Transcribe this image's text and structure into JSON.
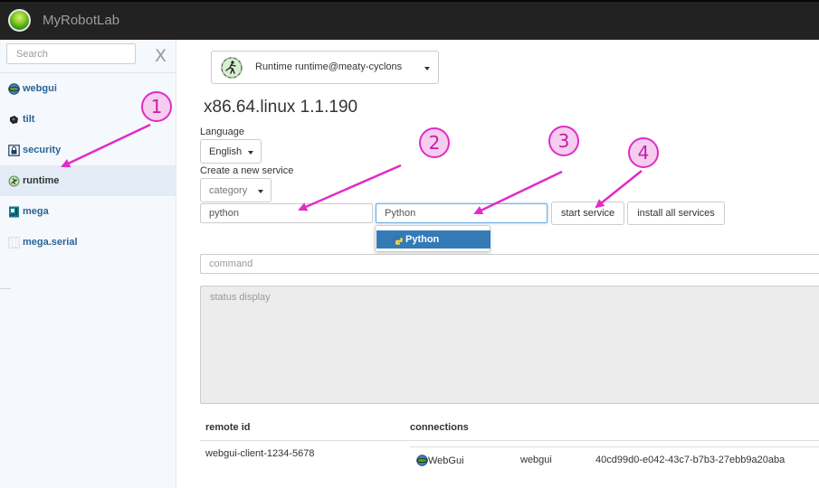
{
  "app": {
    "title": "MyRobotLab"
  },
  "sidebar": {
    "search_placeholder": "Search",
    "close_label": "X",
    "items": [
      {
        "label": "webgui",
        "icon": "webgui-globe-icon"
      },
      {
        "label": "tilt",
        "icon": "tilt-icon"
      },
      {
        "label": "security",
        "icon": "lock-icon"
      },
      {
        "label": "runtime",
        "icon": "runtime-icon",
        "active": true
      },
      {
        "label": "mega",
        "icon": "arduino-board-icon"
      },
      {
        "label": "mega.serial",
        "icon": "serial-port-icon"
      }
    ]
  },
  "runtime_selector": {
    "label": "Runtime  runtime@meaty-cyclons"
  },
  "platform": {
    "version": "x86.64.linux 1.1.190"
  },
  "language": {
    "label": "Language",
    "value": "English"
  },
  "create_service": {
    "label": "Create a new service",
    "category_value": "category",
    "name_value": "python",
    "type_value": "Python",
    "start_label": "start service",
    "install_all_label": "install all services",
    "suggestion": {
      "label": "Python",
      "icon": "python-icon"
    }
  },
  "command": {
    "placeholder": "command"
  },
  "status": {
    "placeholder": "status display"
  },
  "connections_table": {
    "headers": {
      "remote_id": "remote id",
      "connections": "connections"
    },
    "rows": [
      {
        "remote_id": "webgui-client-1234-5678",
        "connection": {
          "icon": "webgui-globe-icon",
          "name": "WebGui",
          "service": "webgui",
          "id": "40cd99d0-e042-43c7-b7b3-27ebb9a20aba"
        }
      }
    ]
  },
  "annotations": {
    "step1": "1",
    "step2": "2",
    "step3": "3",
    "step4": "4"
  },
  "colors": {
    "navbar": "#222222",
    "sidebar": "#f5f8fd",
    "link": "#2a6496",
    "annotation": "#e02cc6",
    "highlight": "#337ab7"
  }
}
